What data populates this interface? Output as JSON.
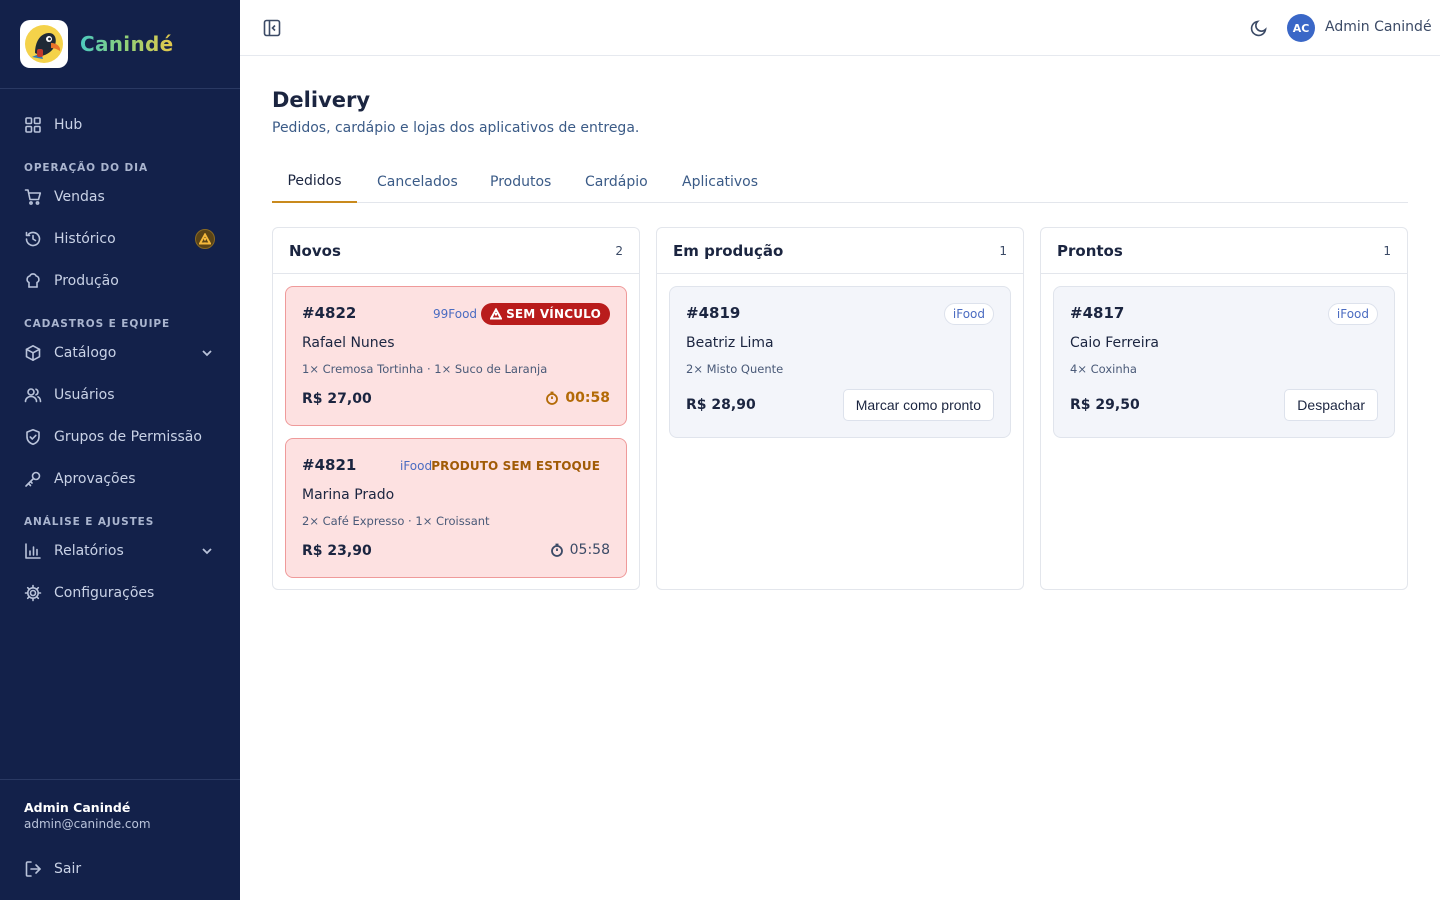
{
  "brand": {
    "name": "Canindé"
  },
  "sidebar": {
    "hub": "Hub",
    "section_operacao": "OPERAÇÃO DO DIA",
    "vendas": "Vendas",
    "historico": "Histórico",
    "producao": "Produção",
    "section_cadastros": "CADASTROS E EQUIPE",
    "catalogo": "Catálogo",
    "usuarios": "Usuários",
    "grupos": "Grupos de Permissão",
    "aprovacoes": "Aprovações",
    "section_analise": "ANÁLISE E AJUSTES",
    "relatorios": "Relatórios",
    "configuracoes": "Configurações"
  },
  "footer": {
    "user_name": "Admin Canindé",
    "user_email": "admin@caninde.com",
    "logout": "Sair"
  },
  "topbar": {
    "avatar_initials": "AC",
    "user_name": "Admin Canindé"
  },
  "page": {
    "title": "Delivery",
    "subtitle": "Pedidos, cardápio e lojas dos aplicativos de entrega."
  },
  "tabs": [
    "Pedidos",
    "Cancelados",
    "Produtos",
    "Cardápio",
    "Aplicativos"
  ],
  "columns": [
    {
      "title": "Novos",
      "count": "2",
      "cards": [
        {
          "id": "#4822",
          "app": "99Food",
          "badge": "SEM VÍNCULO",
          "customer": "Rafael Nunes",
          "items": "1× Cremosa Tortinha · 1× Suco de Laranja",
          "price": "R$ 27,00",
          "timer": "00:58"
        },
        {
          "id": "#4821",
          "app": "iFood",
          "badge": "PRODUTO SEM ESTOQUE",
          "customer": "Marina Prado",
          "items": "2× Café Expresso · 1× Croissant",
          "price": "R$ 23,90",
          "timer": "05:58"
        }
      ]
    },
    {
      "title": "Em produção",
      "count": "1",
      "cards": [
        {
          "id": "#4819",
          "app": "iFood",
          "customer": "Beatriz Lima",
          "items": "2× Misto Quente",
          "price": "R$ 28,90",
          "action": "Marcar como pronto"
        }
      ]
    },
    {
      "title": "Prontos",
      "count": "1",
      "cards": [
        {
          "id": "#4817",
          "app": "iFood",
          "customer": "Caio Ferreira",
          "items": "4× Coxinha",
          "price": "R$ 29,50",
          "action": "Despachar"
        }
      ]
    }
  ]
}
